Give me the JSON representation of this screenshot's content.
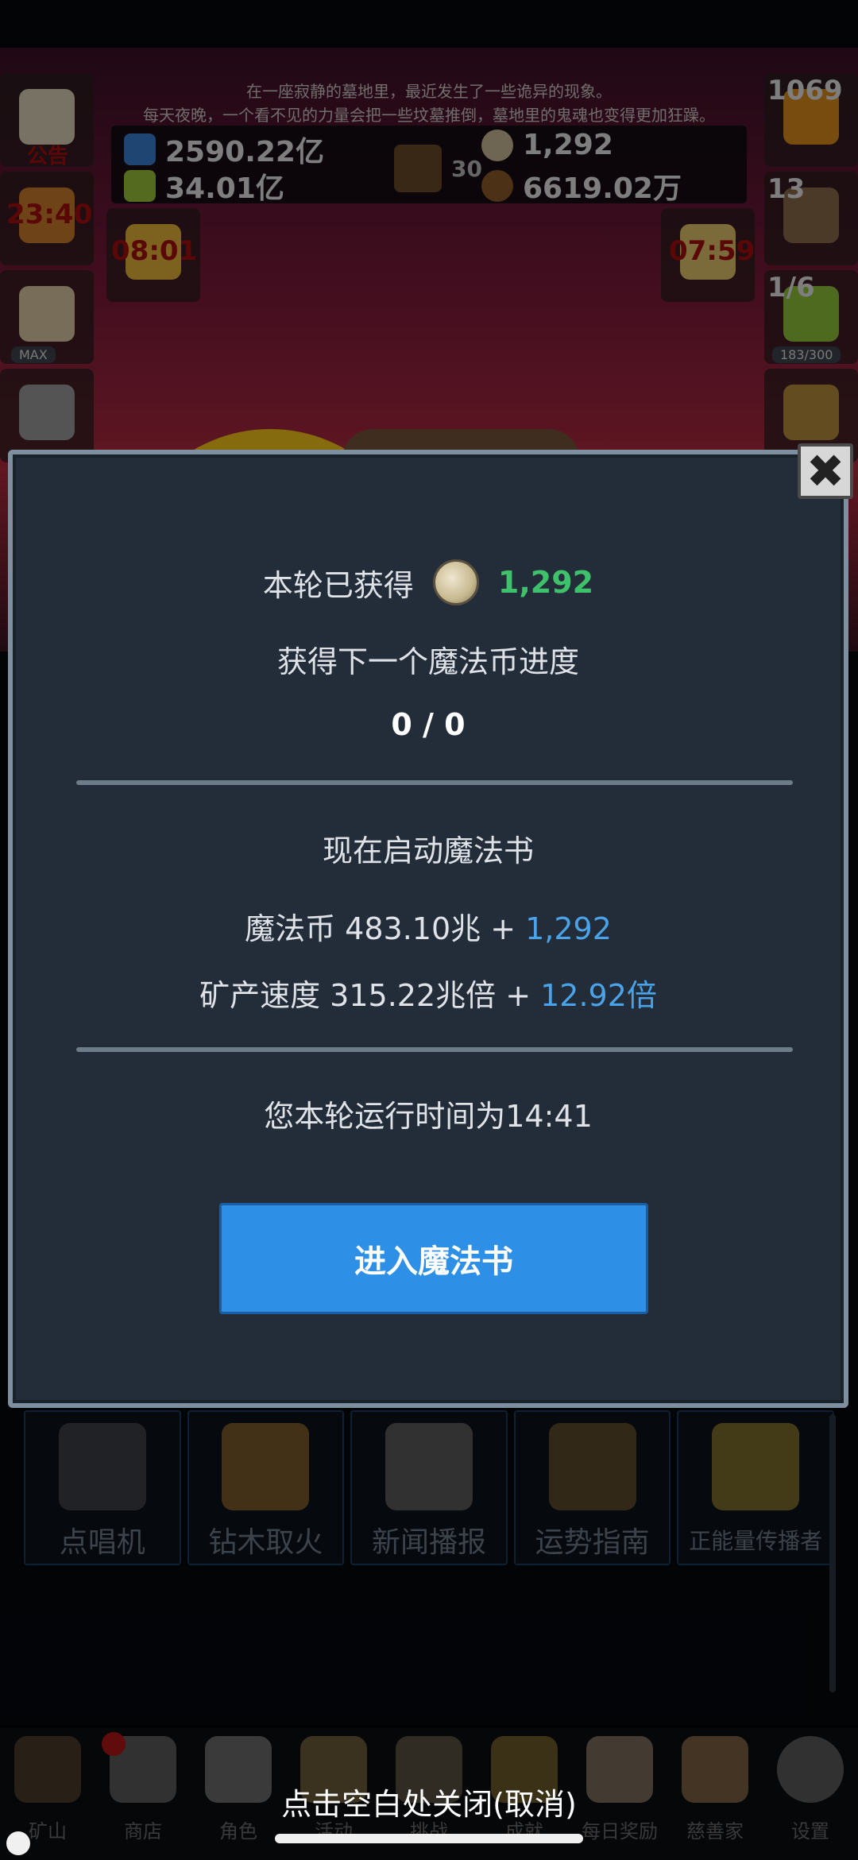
{
  "story": {
    "line1": "在一座寂静的墓地里，最近发生了一些诡异的现象。",
    "line2": "每天夜晚，一个看不见的力量会把一些坟墓推倒，墓地里的鬼魂也变得更加狂躁。"
  },
  "resources": {
    "potion_blue": "2590.22亿",
    "potion_green": "34.01亿",
    "book_count": "30",
    "coin": "1,292",
    "chestnut": "6619.02万"
  },
  "left_slots": {
    "notice_label": "公告",
    "torch_timer": "23:40",
    "card_timer": "08:01",
    "chef_badge": "MAX"
  },
  "right_slots": {
    "pot_count": "1069",
    "chest_count": "13",
    "bread_timer": "07:59",
    "slime_progress": "1/6",
    "slime_sub": "183/300"
  },
  "modal": {
    "earned_label": "本轮已获得",
    "earned_value": "1,292",
    "progress_label": "获得下一个魔法币进度",
    "progress_value": "0 / 0",
    "launch_label": "现在启动魔法书",
    "coin_line_prefix": "魔法币 483.10兆 + ",
    "coin_line_bonus": "1,292",
    "speed_line_prefix": "矿产速度 315.22兆倍 + ",
    "speed_line_bonus": "12.92倍",
    "runtime": "您本轮运行时间为14:41",
    "enter_button": "进入魔法书",
    "close_glyph": "✖"
  },
  "features": [
    {
      "label": "点唱机",
      "icon": "jukebox-icon"
    },
    {
      "label": "钻木取火",
      "icon": "fire-drill-icon"
    },
    {
      "label": "新闻播报",
      "icon": "newspaper-icon"
    },
    {
      "label": "运势指南",
      "icon": "fortune-icon"
    },
    {
      "label": "正能量传播者",
      "icon": "crown-icon"
    }
  ],
  "bottom_nav": [
    {
      "label": "矿山",
      "icon": "lantern-icon"
    },
    {
      "label": "商店",
      "icon": "shop-icon"
    },
    {
      "label": "角色",
      "icon": "skull-icon"
    },
    {
      "label": "活动",
      "icon": "scroll-icon"
    },
    {
      "label": "挑战",
      "icon": "map-icon"
    },
    {
      "label": "成就",
      "icon": "key-icon"
    },
    {
      "label": "每日奖励",
      "icon": "letter-icon"
    },
    {
      "label": "慈善家",
      "icon": "bread-icon"
    },
    {
      "label": "设置",
      "icon": "gear-icon"
    }
  ],
  "dismiss_hint": "点击空白处关闭(取消)",
  "colors": {
    "modal_bg": "#232d3a",
    "accent_green": "#3fc06a",
    "accent_blue": "#4aa3e8",
    "button_blue": "#2d8fe6"
  }
}
